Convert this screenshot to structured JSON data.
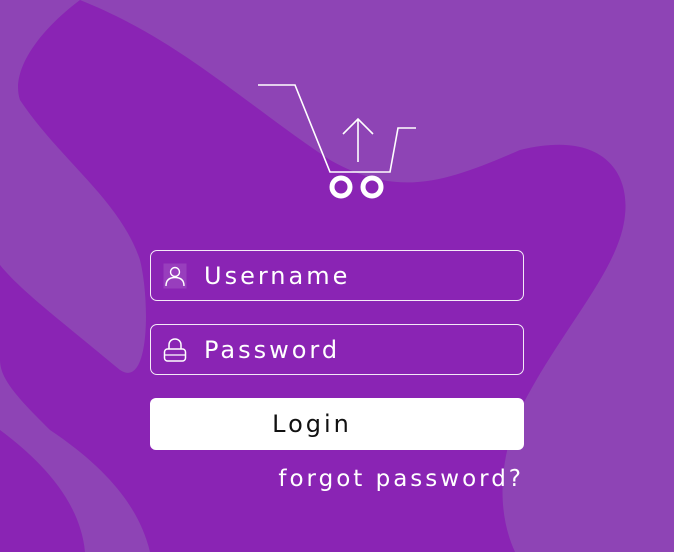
{
  "colors": {
    "background_light": "#8e44b5",
    "background_dark": "#8a24b4",
    "field_border": "#ffffff",
    "button_bg": "#ffffff",
    "button_text": "#111111",
    "text": "#ffffff"
  },
  "logo": {
    "icon": "shopping-cart-upload-icon"
  },
  "username": {
    "placeholder": "Username",
    "icon": "user-icon"
  },
  "password": {
    "placeholder": "Password",
    "icon": "lock-icon"
  },
  "login": {
    "label": "Login"
  },
  "forgot": {
    "label": "forgot password?"
  }
}
